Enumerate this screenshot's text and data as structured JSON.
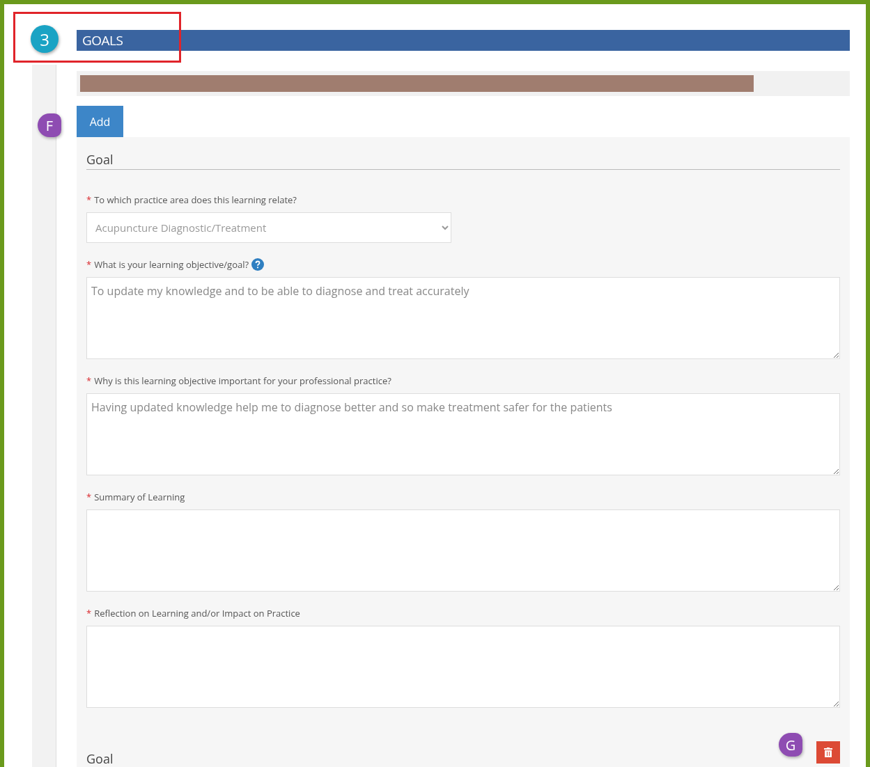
{
  "section": {
    "number": "3",
    "title": "GOALS"
  },
  "progress": {
    "level": 0.875
  },
  "add_button": {
    "label": "Add",
    "callout": "F"
  },
  "goals": [
    {
      "heading": "Goal",
      "fields": [
        {
          "kind": "select",
          "marker": "*",
          "label": "To which practice area does this learning relate?",
          "value": "Acupuncture Diagnostic/Treatment"
        },
        {
          "kind": "textarea",
          "marker": "*",
          "help": true,
          "label": "What is your learning objective/goal?",
          "value": "To update my knowledge and to be able to diagnose and treat accurately"
        },
        {
          "kind": "textarea",
          "marker": "*",
          "label": "Why is this learning objective important for your professional practice?",
          "value": "Having updated knowledge help me to diagnose better and so make treatment safer for the patients"
        },
        {
          "kind": "textarea",
          "marker": "*",
          "label": "Summary of Learning"
        },
        {
          "kind": "textarea",
          "marker": "*",
          "label": "Reflection on Learning and/or Impact on Practice"
        }
      ]
    },
    {
      "heading": "Goal",
      "callout": "G",
      "deletable": true
    }
  ]
}
